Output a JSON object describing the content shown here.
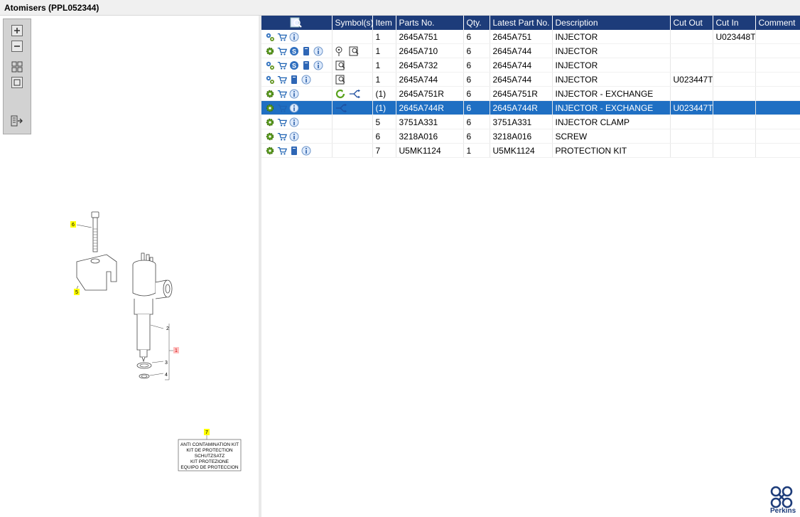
{
  "window": {
    "title": "Atomisers (PPL052344)"
  },
  "toolbar": {
    "buttons": [
      "zoom-in",
      "zoom-out",
      "fit-all",
      "actual-size",
      "export"
    ]
  },
  "diagram": {
    "callouts": [
      "6",
      "5",
      "2",
      "1",
      "3",
      "4",
      "7"
    ],
    "kit_label": [
      "ANTI CONTAMINATION KIT",
      "KIT DE PROTECTION",
      "SCHUTZSATZ",
      "KIT PROTEZIONE",
      "EQUIPO DE PROTECCION"
    ]
  },
  "table": {
    "headers": [
      "",
      "Symbol(s)",
      "Item",
      "Parts No.",
      "Qty.",
      "Latest Part No.",
      "Description",
      "Cut Out",
      "Cut In",
      "Comment"
    ],
    "rows": [
      {
        "icons": [
          "gears",
          "cart",
          "info"
        ],
        "symbols": [],
        "item": "1",
        "part_no": "2645A751",
        "qty": "6",
        "latest": "2645A751",
        "desc": "INJECTOR",
        "cut_out": "",
        "cut_in": "U023448T",
        "comment": ""
      },
      {
        "icons": [
          "gear",
          "cart",
          "s-badge",
          "doc",
          "info"
        ],
        "symbols": [
          "pin-book",
          "book"
        ],
        "item": "1",
        "part_no": "2645A710",
        "qty": "6",
        "latest": "2645A744",
        "desc": "INJECTOR",
        "cut_out": "",
        "cut_in": "",
        "comment": ""
      },
      {
        "icons": [
          "gears",
          "cart",
          "s-badge",
          "doc",
          "info"
        ],
        "symbols": [
          "book"
        ],
        "item": "1",
        "part_no": "2645A732",
        "qty": "6",
        "latest": "2645A744",
        "desc": "INJECTOR",
        "cut_out": "",
        "cut_in": "",
        "comment": ""
      },
      {
        "icons": [
          "gears",
          "cart",
          "doc",
          "info"
        ],
        "symbols": [
          "book"
        ],
        "item": "1",
        "part_no": "2645A744",
        "qty": "6",
        "latest": "2645A744",
        "desc": "INJECTOR",
        "cut_out": "U023447T",
        "cut_in": "",
        "comment": ""
      },
      {
        "icons": [
          "gear",
          "cart",
          "info"
        ],
        "symbols": [
          "exchange",
          "split"
        ],
        "item": "(1)",
        "part_no": "2645A751R",
        "qty": "6",
        "latest": "2645A751R",
        "desc": "INJECTOR - EXCHANGE",
        "cut_out": "",
        "cut_in": "",
        "comment": ""
      },
      {
        "icons": [
          "gear",
          "cart",
          "info"
        ],
        "symbols": [
          "split"
        ],
        "item": "(1)",
        "part_no": "2645A744R",
        "qty": "6",
        "latest": "2645A744R",
        "desc": "INJECTOR - EXCHANGE",
        "cut_out": "U023447T",
        "cut_in": "",
        "comment": ""
      },
      {
        "icons": [
          "gear",
          "cart",
          "info"
        ],
        "symbols": [],
        "item": "5",
        "part_no": "3751A331",
        "qty": "6",
        "latest": "3751A331",
        "desc": "INJECTOR CLAMP",
        "cut_out": "",
        "cut_in": "",
        "comment": ""
      },
      {
        "icons": [
          "gear",
          "cart",
          "info"
        ],
        "symbols": [],
        "item": "6",
        "part_no": "3218A016",
        "qty": "6",
        "latest": "3218A016",
        "desc": "SCREW",
        "cut_out": "",
        "cut_in": "",
        "comment": ""
      },
      {
        "icons": [
          "gear",
          "cart",
          "doc",
          "info"
        ],
        "symbols": [],
        "item": "7",
        "part_no": "U5MK1124",
        "qty": "1",
        "latest": "U5MK1124",
        "desc": "PROTECTION KIT",
        "cut_out": "",
        "cut_in": "",
        "comment": ""
      }
    ],
    "selected_row": 5
  },
  "brand": {
    "name": "Perkins",
    "color": "#1d3c7a"
  },
  "colors": {
    "header_bg": "#1d3c7a",
    "selection": "#1f6fc3"
  }
}
